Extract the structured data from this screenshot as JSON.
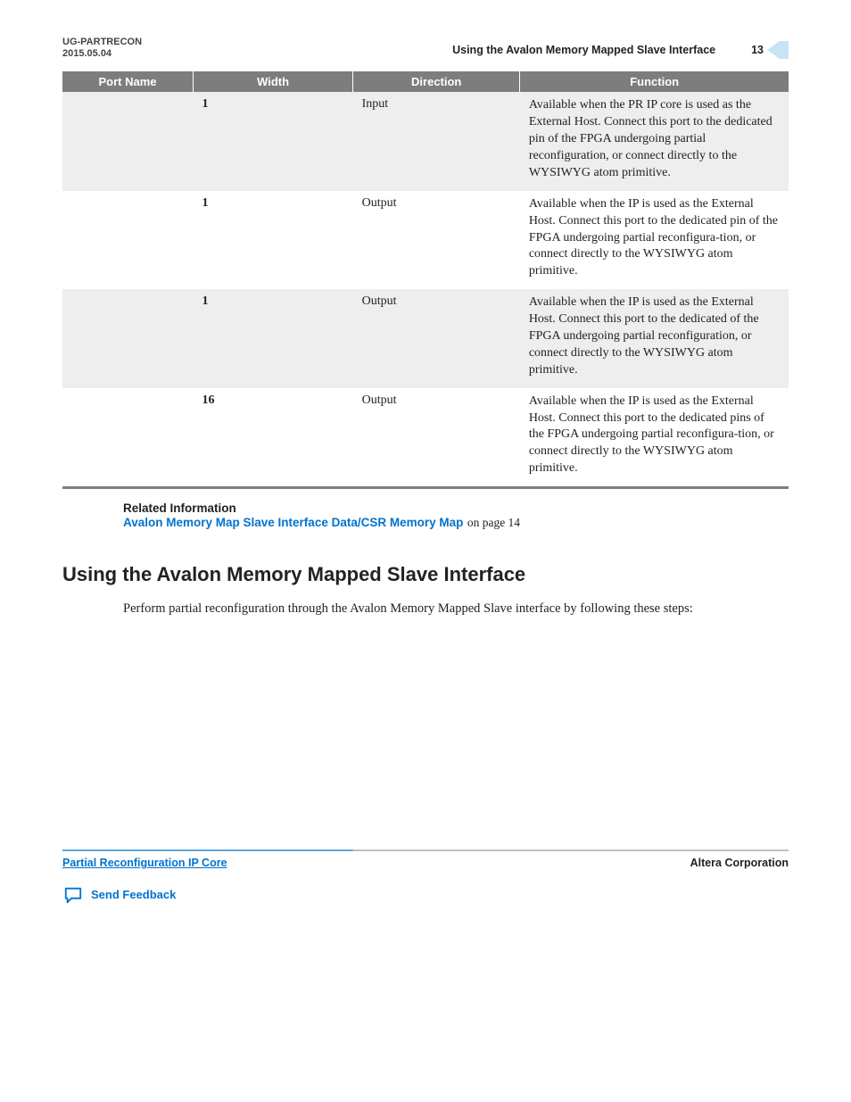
{
  "header": {
    "doc_id": "UG-PARTRECON",
    "date": "2015.05.04",
    "running_head": "Using the Avalon Memory Mapped Slave Interface",
    "page_number": "13"
  },
  "table": {
    "columns": [
      "Port Name",
      "Width",
      "Direction",
      "Function"
    ],
    "rows": [
      {
        "port": "",
        "width": "1",
        "direction": "Input",
        "function": "Available when the PR IP core is used as the External Host. Connect this port to the dedicated                     pin of the FPGA undergoing partial reconfiguration, or connect directly to the                         WYSIWYG atom primitive."
      },
      {
        "port": "",
        "width": "1",
        "direction": "Output",
        "function": "Available when the IP is used as the External Host. Connect this port to the dedicated                   pin of the FPGA undergoing partial reconfigura‐tion, or connect directly to the                           WYSIWYG atom primitive."
      },
      {
        "port": "",
        "width": "1",
        "direction": "Output",
        "function": "Available when the IP is used as the External Host. Connect this port to the dedicated               of the FPGA undergoing partial reconfiguration, or connect directly to the                         WYSIWYG atom primitive."
      },
      {
        "port": "",
        "width": "16",
        "direction": "Output",
        "function": "Available when the IP is used as the External Host. Connect this port to the dedicated                   pins of the FPGA undergoing partial reconfigura‐tion, or connect directly to the                           WYSIWYG atom primitive."
      }
    ]
  },
  "related": {
    "heading": "Related Information",
    "link_text": "Avalon Memory Map Slave Interface Data/CSR Memory Map",
    "suffix": " on page 14"
  },
  "section": {
    "title": "Using the Avalon Memory Mapped Slave Interface",
    "body": "Perform partial reconfiguration through the Avalon Memory Mapped Slave interface by following these steps:"
  },
  "footer": {
    "left": "Partial Reconfiguration IP Core",
    "right": "Altera Corporation",
    "feedback": "Send Feedback"
  }
}
